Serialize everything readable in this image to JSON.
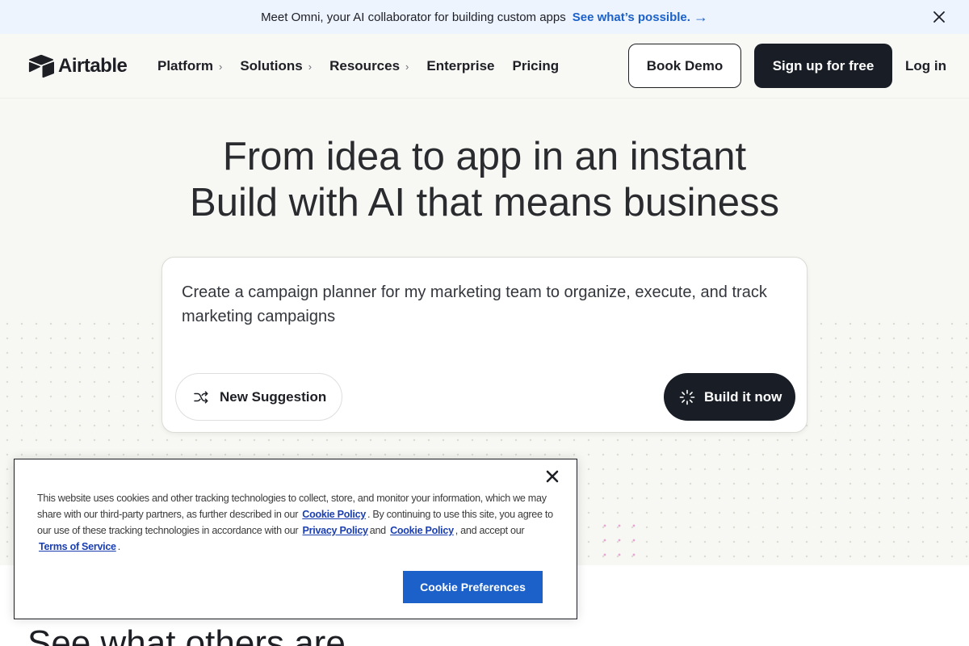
{
  "announcement": {
    "message": "Meet Omni, your AI collaborator for building custom apps",
    "link": "See what’s possible.",
    "arrow": "→"
  },
  "header": {
    "logo_text": "Airtable",
    "nav": [
      {
        "label": "Platform",
        "has_chevron": true
      },
      {
        "label": "Solutions",
        "has_chevron": true
      },
      {
        "label": "Resources",
        "has_chevron": true
      },
      {
        "label": "Enterprise",
        "has_chevron": false
      },
      {
        "label": "Pricing",
        "has_chevron": false
      }
    ],
    "chevron": "›",
    "book_demo": "Book Demo",
    "sign_up": "Sign up for free",
    "log_in": "Log in"
  },
  "hero": {
    "title_line1": "From idea to app in an instant",
    "title_line2": "Build with AI that means business",
    "prompt": "Create a campaign planner for my marketing team to organize, execute, and track marketing campaigns",
    "new_suggestion": "New Suggestion",
    "build_now": "Build it now"
  },
  "section": {
    "heading": "See what others are"
  },
  "cookie": {
    "text_1": "This website uses cookies and other tracking technologies to collect, store, and monitor your information, which we may share with our third-party partners, as further described in our",
    "link_cookie_policy": "Cookie Policy",
    "text_2": ". By continuing to use this site, you agree to our use of these tracking technologies in accordance with our",
    "link_privacy_policy": "Privacy Policy",
    "text_3": "and",
    "link_cookie_policy_2": "Cookie Policy",
    "text_4": ", and accept our",
    "link_terms": "Terms of Service",
    "text_5": ".",
    "preferences_button": "Cookie Preferences"
  },
  "colors": {
    "accent_blue": "#1b61c9",
    "dark_button": "#181d26",
    "hero_background": "#f7f7f3"
  }
}
